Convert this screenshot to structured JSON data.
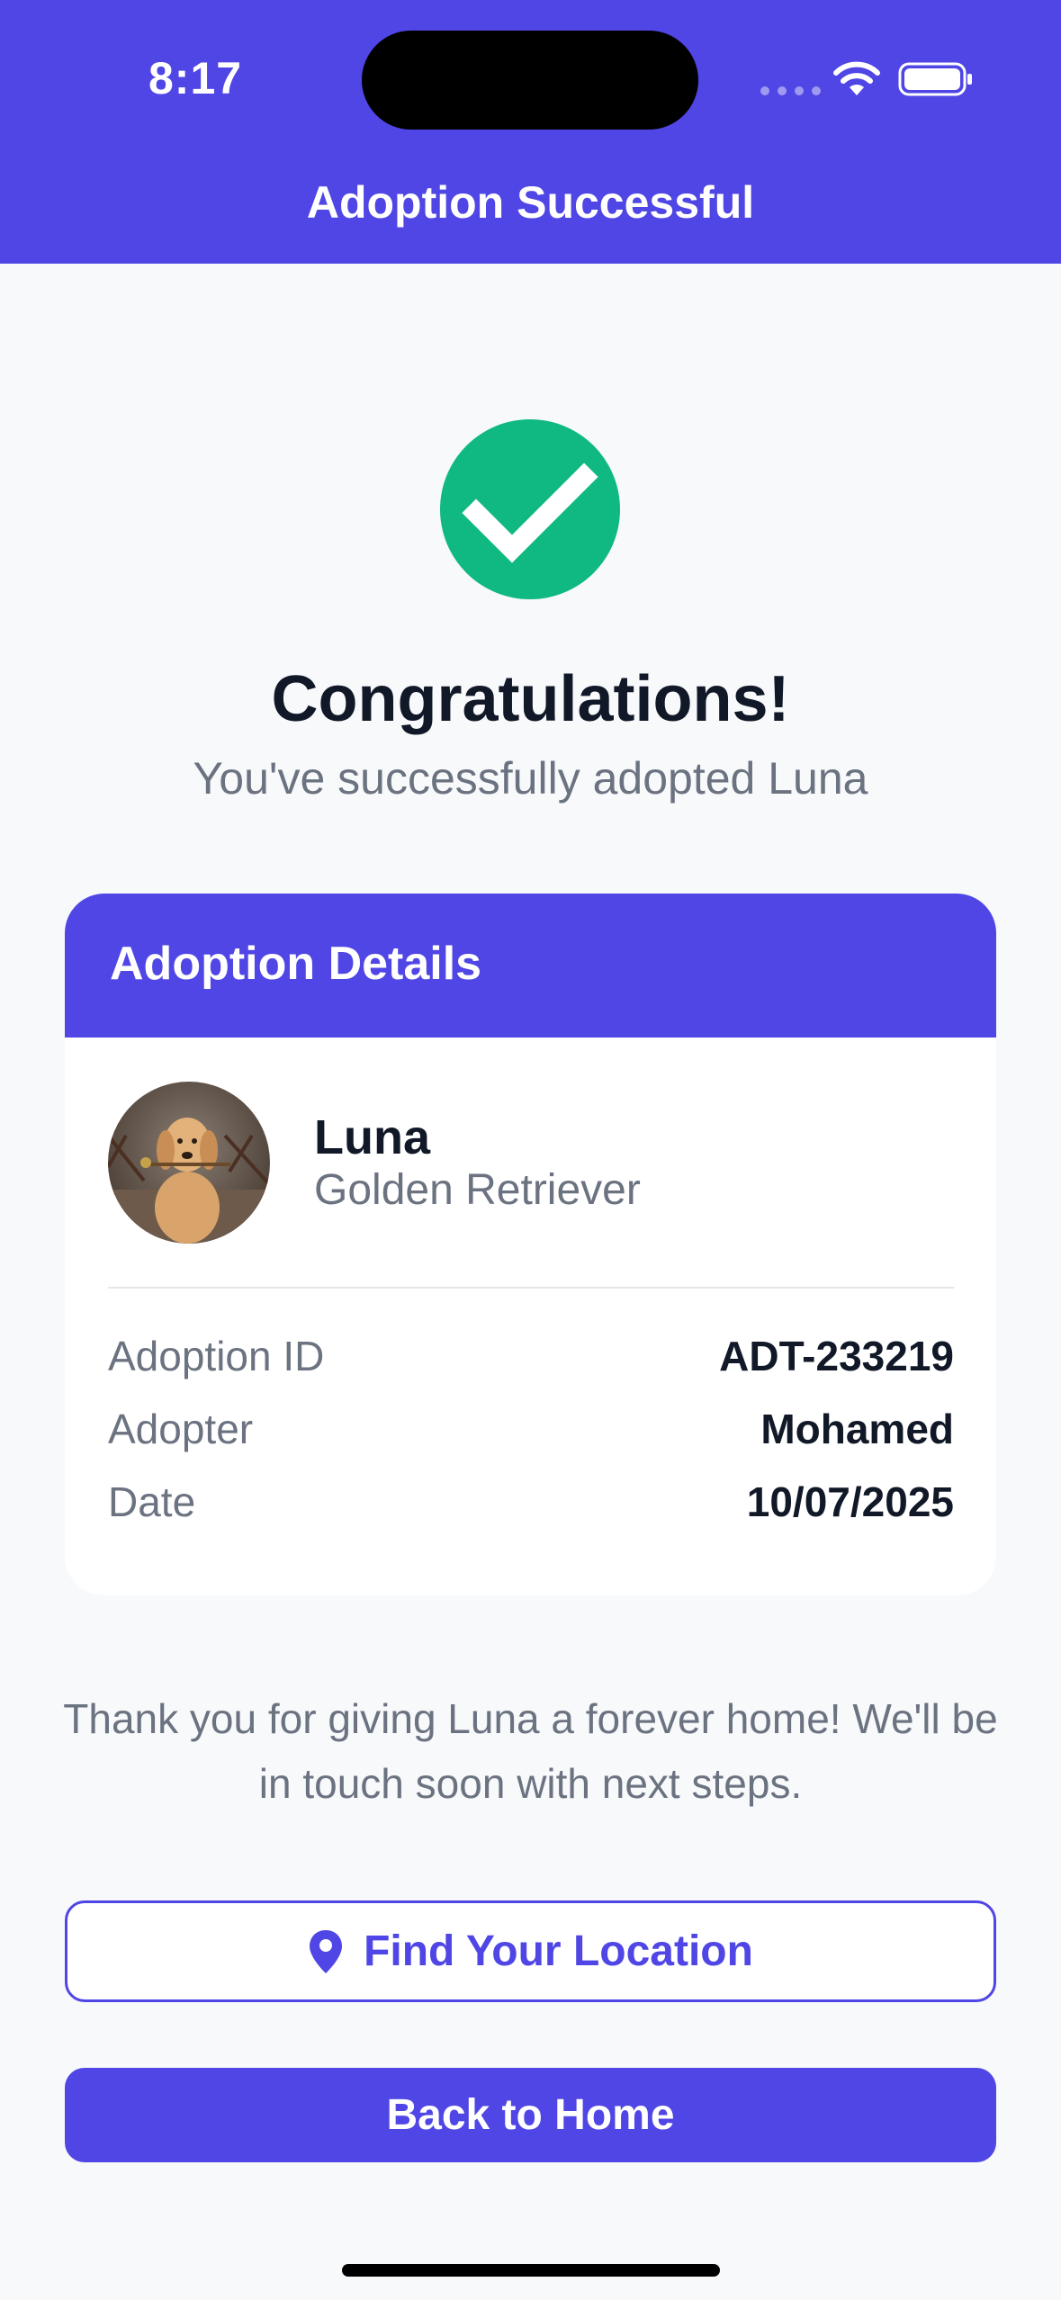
{
  "status_bar": {
    "time": "8:17"
  },
  "header": {
    "title": "Adoption Successful"
  },
  "success": {
    "heading": "Congratulations!",
    "subtitle": "You've successfully adopted Luna"
  },
  "card": {
    "title": "Adoption Details",
    "pet": {
      "name": "Luna",
      "breed": "Golden Retriever"
    },
    "rows": [
      {
        "label": "Adoption ID",
        "value": "ADT-233219"
      },
      {
        "label": "Adopter",
        "value": "Mohamed"
      },
      {
        "label": "Date",
        "value": "10/07/2025"
      }
    ]
  },
  "thanks_message": "Thank you for giving Luna a forever home! We'll be in touch soon with next steps.",
  "buttons": {
    "location_label": "Find Your Location",
    "location_icon": "map-pin-icon",
    "home_label": "Back to Home"
  },
  "colors": {
    "primary": "#4f46e5",
    "success": "#10b981",
    "background": "#f7f9fb"
  }
}
